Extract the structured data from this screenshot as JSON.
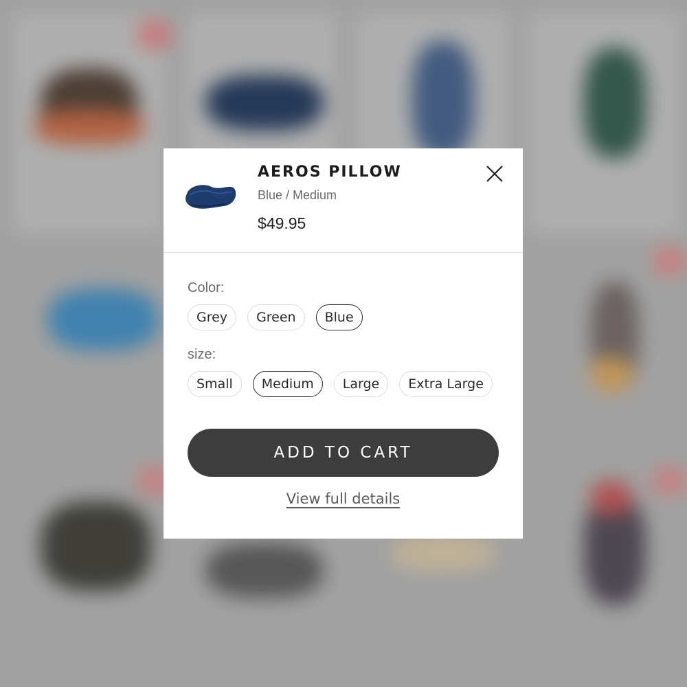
{
  "product": {
    "title": "AEROS PILLOW",
    "variant": "Blue / Medium",
    "price": "$49.95",
    "thumbnail_icon": "pillow-image",
    "thumbnail_color": "#1f3c6e"
  },
  "options": {
    "color": {
      "label": "Color:",
      "values": [
        "Grey",
        "Green",
        "Blue"
      ],
      "selected": "Blue"
    },
    "size": {
      "label": "size:",
      "values": [
        "Small",
        "Medium",
        "Large",
        "Extra Large"
      ],
      "selected": "Medium"
    }
  },
  "actions": {
    "add_to_cart": "ADD TO CART",
    "view_details": "View full details",
    "close_icon": "close-icon"
  },
  "colors": {
    "button_bg": "#3d3d3d",
    "backdrop": "#a6a6a6"
  }
}
